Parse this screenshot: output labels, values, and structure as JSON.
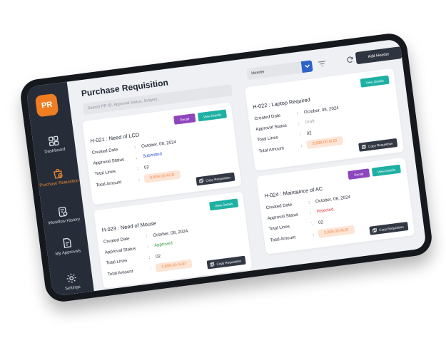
{
  "app": {
    "logo": "PR",
    "title": "Purchase Requisition"
  },
  "search": {
    "placeholder": "Search PR ID, Approval Status, Subject..."
  },
  "header_select": {
    "value": "Header"
  },
  "add_header_label": "Add Header",
  "sidebar": {
    "items": [
      {
        "label": "Dashboard",
        "icon": "dashboard-icon"
      },
      {
        "label": "Purchase Requistion",
        "icon": "purchase-bag-icon",
        "active": true
      },
      {
        "label": "Workflow History",
        "icon": "workflow-history-icon"
      },
      {
        "label": "My Approvals",
        "icon": "approvals-icon"
      },
      {
        "label": "Settings",
        "icon": "gear-icon"
      }
    ]
  },
  "labels": {
    "created_date": "Created Date",
    "approval_status": "Approval Status",
    "total_lines": "Total Lines",
    "total_amount": "Total Amount",
    "colon": ":",
    "recall": "Recall",
    "view_details": "View Details",
    "copy_requisition": "Copy Requisition"
  },
  "cards": [
    {
      "title": "H-021 : Need of LCD",
      "created_date": "October, 08, 2024",
      "status": "Submitted",
      "status_color": "#2d4fd1",
      "total_lines": "02",
      "total_amount": "3,899.00 AUD",
      "has_recall": true
    },
    {
      "title": "H-022 : Laptop Required",
      "created_date": "October, 08, 2024",
      "status": "Draft",
      "status_color": "#9aa0a8",
      "total_lines": "02",
      "total_amount": "3,899.00 AUD",
      "has_recall": false
    },
    {
      "title": "H-023 : Need of Mouse",
      "created_date": "October, 08, 2024",
      "status": "Approved",
      "status_color": "#2e9a3a",
      "total_lines": "02",
      "total_amount": "3,899.00 AUD",
      "has_recall": false
    },
    {
      "title": "H-024 : Maintaince of AC",
      "created_date": "October, 08, 2024",
      "status": "Rejected",
      "status_color": "#e0383e",
      "total_lines": "02",
      "total_amount": "3,899.00 AUD",
      "has_recall": true
    }
  ],
  "colors": {
    "accent_orange": "#ef7d22",
    "sidebar_bg": "#262d38",
    "teal": "#1fb0a4",
    "purple": "#8d46bd",
    "select_blue": "#2d63c8"
  }
}
